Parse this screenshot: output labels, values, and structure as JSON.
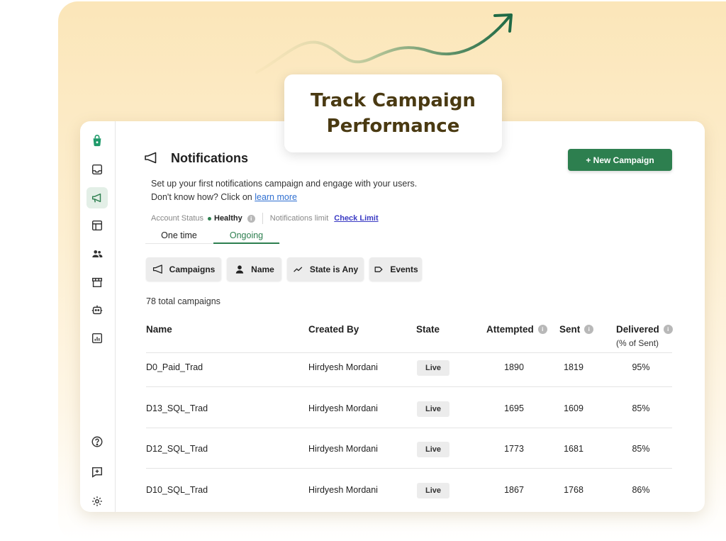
{
  "hero": {
    "title_line1": "Track Campaign",
    "title_line2": "Performance"
  },
  "colors": {
    "brand_green": "#2d7f4f",
    "background_warm": "#fbe6b9"
  },
  "sidebar": {
    "items": [
      {
        "icon": "app-logo-icon"
      },
      {
        "icon": "inbox-icon"
      },
      {
        "icon": "megaphone-icon",
        "active": true
      },
      {
        "icon": "layout-icon"
      },
      {
        "icon": "users-icon"
      },
      {
        "icon": "store-icon"
      },
      {
        "icon": "bot-icon"
      },
      {
        "icon": "chart-icon"
      },
      {
        "icon": "help-icon"
      },
      {
        "icon": "feedback-icon"
      },
      {
        "icon": "gear-icon"
      }
    ]
  },
  "page": {
    "title": "Notifications",
    "new_campaign_label": "+ New Campaign",
    "description_line1": "Set up your first notifications campaign and engage with your users.",
    "description_line2_prefix": "Don't know how? Click on ",
    "learn_more_label": "learn more",
    "account_status_label": "Account Status",
    "account_status_value": "Healthy",
    "notifications_limit_label": "Notifications limit",
    "check_limit_label": "Check Limit"
  },
  "tabs": [
    {
      "label": "One time",
      "active": false
    },
    {
      "label": "Ongoing",
      "active": true
    }
  ],
  "filters": [
    {
      "label": "Campaigns",
      "icon": "megaphone-icon"
    },
    {
      "label": "Name",
      "icon": "person-icon"
    },
    {
      "label": "State is Any",
      "icon": "trend-icon"
    },
    {
      "label": "Events",
      "icon": "tag-icon"
    }
  ],
  "total_campaigns": "78 total campaigns",
  "table": {
    "headers": {
      "name": "Name",
      "created_by": "Created By",
      "state": "State",
      "attempted": "Attempted",
      "sent": "Sent",
      "delivered": "Delivered",
      "delivered_sub": "(% of Sent)"
    },
    "rows": [
      {
        "name": "D0_Paid_Trad",
        "created_by": "Hirdyesh Mordani",
        "state": "Live",
        "attempted": "1890",
        "sent": "1819",
        "delivered": "95%"
      },
      {
        "name": "D13_SQL_Trad",
        "created_by": "Hirdyesh Mordani",
        "state": "Live",
        "attempted": "1695",
        "sent": "1609",
        "delivered": "85%"
      },
      {
        "name": "D12_SQL_Trad",
        "created_by": "Hirdyesh Mordani",
        "state": "Live",
        "attempted": "1773",
        "sent": "1681",
        "delivered": "85%"
      },
      {
        "name": "D10_SQL_Trad",
        "created_by": "Hirdyesh Mordani",
        "state": "Live",
        "attempted": "1867",
        "sent": "1768",
        "delivered": "86%"
      }
    ]
  }
}
